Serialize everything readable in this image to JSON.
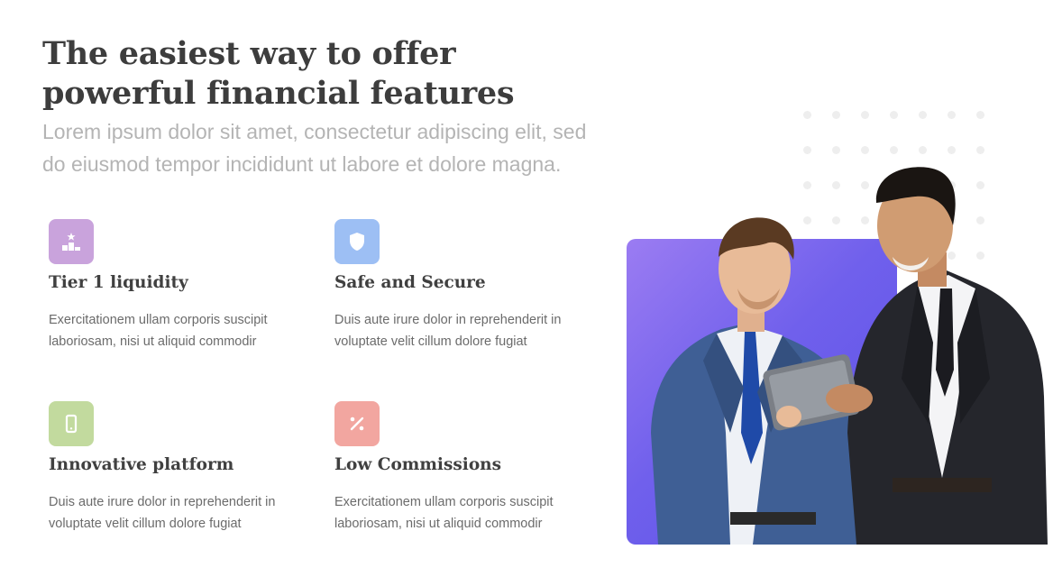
{
  "heading": "The easiest way to offer powerful financial features",
  "subtitle": "Lorem ipsum dolor sit amet, consectetur adipiscing elit, sed do eiusmod tempor incididunt ut labore et dolore magna.",
  "features": [
    {
      "title": "Tier 1 liquidity",
      "description": "Exercitationem ullam corporis suscipit laboriosam, nisi ut aliquid commodir",
      "icon": "podium-icon",
      "color": "#c9a3dc"
    },
    {
      "title": "Safe and Secure",
      "description": "Duis aute irure dolor in reprehenderit in voluptate velit cillum dolore fugiat",
      "icon": "shield-icon",
      "color": "#9dbff4"
    },
    {
      "title": "Innovative platform",
      "description": "Duis aute irure dolor in reprehenderit in voluptate velit cillum dolore fugiat",
      "icon": "mobile-phone-icon",
      "color": "#c2da9e"
    },
    {
      "title": "Low Commissions",
      "description": "Exercitationem ullam corporis suscipit laboriosam, nisi ut aliquid commodir",
      "icon": "percent-icon",
      "color": "#f2a6a0"
    }
  ],
  "image": {
    "subject": "business-people-with-tablet-photo",
    "accent_gradient": [
      "#9b7cf2",
      "#5a50e6"
    ]
  }
}
